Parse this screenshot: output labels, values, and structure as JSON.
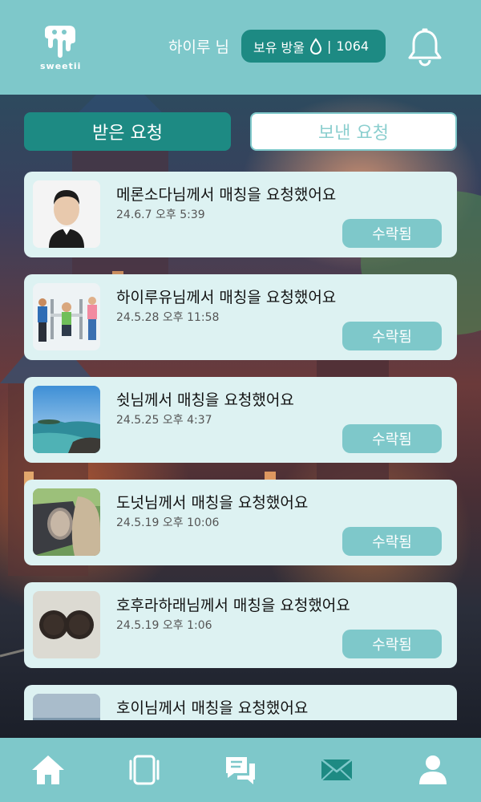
{
  "header": {
    "logo_text": "sweetii",
    "greeting": "하이루 님",
    "points_label": "보유 방울",
    "points_separator": "|",
    "points_value": "1064"
  },
  "tabs": [
    {
      "label": "받은 요청",
      "active": true
    },
    {
      "label": "보낸 요청",
      "active": false
    }
  ],
  "requests": [
    {
      "message": "메론소다님께서 매칭을 요청했어요",
      "time": "24.6.7 오후 5:39",
      "status": "수락됨"
    },
    {
      "message": "하이루유님께서 매칭을 요청했어요",
      "time": "24.5.28 오후 11:58",
      "status": "수락됨"
    },
    {
      "message": "쉿님께서 매칭을 요청했어요",
      "time": "24.5.25 오후 4:37",
      "status": "수락됨"
    },
    {
      "message": "도넛님께서 매칭을 요청했어요",
      "time": "24.5.19 오후 10:06",
      "status": "수락됨"
    },
    {
      "message": "호후라하래님께서 매칭을 요청했어요",
      "time": "24.5.19 오후 1:06",
      "status": "수락됨"
    },
    {
      "message": "호이님께서 매칭을 요청했어요",
      "time": "",
      "status": ""
    }
  ],
  "colors": {
    "primary": "#7ec8ca",
    "accent": "#1d8a83",
    "card": "#ddf2f2"
  },
  "nav": [
    "home-icon",
    "cards-icon",
    "chat-icon",
    "mail-icon",
    "profile-icon"
  ]
}
